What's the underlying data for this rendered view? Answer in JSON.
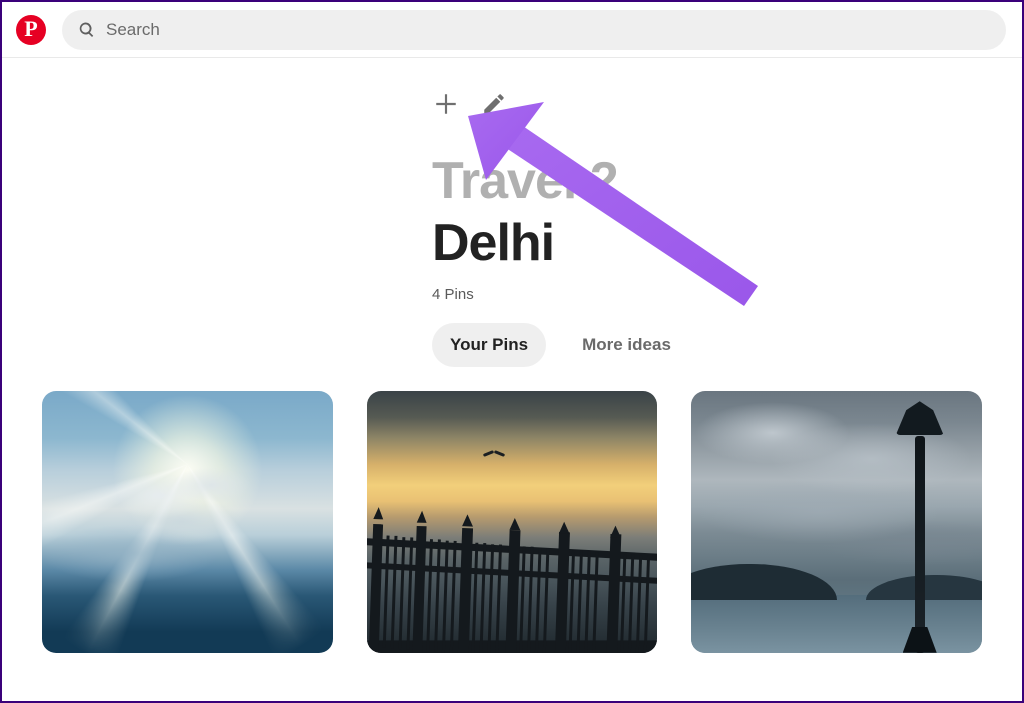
{
  "header": {
    "search_placeholder": "Search"
  },
  "board": {
    "parent_name": "Travel 2",
    "title": "Delhi",
    "pin_count_label": "4 Pins",
    "tabs": {
      "your_pins": "Your Pins",
      "more_ideas": "More ideas"
    }
  },
  "icons": {
    "logo_letter": "P"
  }
}
